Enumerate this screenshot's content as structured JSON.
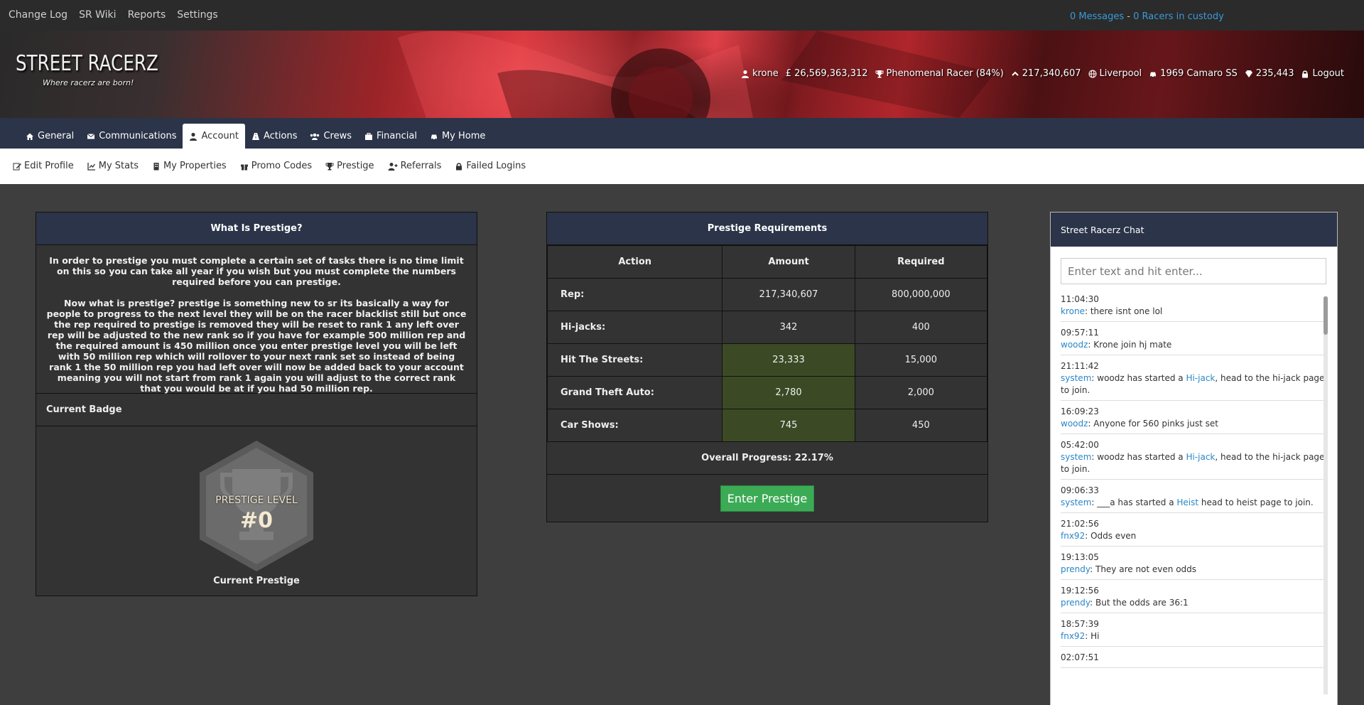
{
  "topbar": {
    "links": [
      "Change Log",
      "SR Wiki",
      "Reports",
      "Settings"
    ],
    "messages": "0 Messages",
    "separator": " - ",
    "custody": "0 Racers in custody"
  },
  "logo": {
    "title": "STREET RACERZ",
    "tagline": "Where racerz are born!"
  },
  "user": {
    "name": "krone",
    "cash": "£ 26,569,363,312",
    "rank": "Phenomenal Racer (84%)",
    "rep": "217,340,607",
    "city": "Liverpool",
    "car": "1969 Camaro SS",
    "points": "235,443",
    "logout": "Logout"
  },
  "nav": {
    "tabs": [
      {
        "label": "General",
        "icon": "home-icon"
      },
      {
        "label": "Communications",
        "icon": "envelope-icon"
      },
      {
        "label": "Account",
        "icon": "user-icon"
      },
      {
        "label": "Actions",
        "icon": "road-icon"
      },
      {
        "label": "Crews",
        "icon": "users-icon"
      },
      {
        "label": "Financial",
        "icon": "briefcase-icon"
      },
      {
        "label": "My Home",
        "icon": "car-icon"
      }
    ],
    "active": "Account"
  },
  "subnav": {
    "items": [
      {
        "label": "Edit Profile",
        "icon": "edit-icon"
      },
      {
        "label": "My Stats",
        "icon": "chart-icon"
      },
      {
        "label": "My Properties",
        "icon": "building-icon"
      },
      {
        "label": "Promo Codes",
        "icon": "gift-icon"
      },
      {
        "label": "Prestige",
        "icon": "trophy-icon"
      },
      {
        "label": "Referrals",
        "icon": "user-plus-icon"
      },
      {
        "label": "Failed Logins",
        "icon": "lock-icon"
      }
    ]
  },
  "info": {
    "title": "What Is Prestige?",
    "para1": "In order to prestige you must complete a certain set of tasks there is no time limit on this so you can take all year if you wish but you must complete the numbers required before you can prestige.",
    "para2": "Now what is prestige? prestige is something new to sr its basically a way for people to progress to the next level they will be on the racer blacklist still but once the rep required to prestige is removed they will be reset to rank 1 any left over rep will be adjusted to the new rank so if you have for example 500 million rep and the required amount is 450 million once you enter prestige level you will be left with 50 million rep which will rollover to your next rank set so instead of being rank 1 the 50 million rep you had left over will now be added back to your account meaning you will not start from rank 1 again you will adjust to the correct rank that you would be at if you had 50 million rep.",
    "badge_label": "Current Badge",
    "badge_line1": "PRESTIGE LEVEL",
    "badge_line2": "#0",
    "badge_caption": "Current Prestige"
  },
  "requirements": {
    "title": "Prestige Requirements",
    "headers": [
      "Action",
      "Amount",
      "Required"
    ],
    "rows": [
      {
        "action": "Rep:",
        "amount": "217,340,607",
        "required": "800,000,000",
        "met": false
      },
      {
        "action": "Hi-jacks:",
        "amount": "342",
        "required": "400",
        "met": false
      },
      {
        "action": "Hit The Streets:",
        "amount": "23,333",
        "required": "15,000",
        "met": true
      },
      {
        "action": "Grand Theft Auto:",
        "amount": "2,780",
        "required": "2,000",
        "met": true
      },
      {
        "action": "Car Shows:",
        "amount": "745",
        "required": "450",
        "met": true
      }
    ],
    "overall": "Overall Progress: 22.17%",
    "button": "Enter Prestige",
    "met_color": "#3b4a24"
  },
  "chat": {
    "title": "Street Racerz Chat",
    "placeholder": "Enter text and hit enter...",
    "messages": [
      {
        "time": "11:04:30",
        "user": "krone",
        "text": "there isnt one lol"
      },
      {
        "time": "09:57:11",
        "user": "woodz",
        "text": "Krone join hj mate"
      },
      {
        "time": "21:11:42",
        "user": "system",
        "pre": "woodz has started a ",
        "link": "Hi-jack",
        "post": ", head to the hi-jack page to join."
      },
      {
        "time": "16:09:23",
        "user": "woodz",
        "text": "Anyone for 560 pinks just set"
      },
      {
        "time": "05:42:00",
        "user": "system",
        "pre": "woodz has started a ",
        "link": "Hi-jack",
        "post": ", head to the hi-jack page to join."
      },
      {
        "time": "09:06:33",
        "user": "system",
        "pre": "___a has started a ",
        "link": "Heist",
        "post": " head to heist page to join."
      },
      {
        "time": "21:02:56",
        "user": "fnx92",
        "text": "Odds even"
      },
      {
        "time": "19:13:05",
        "user": "prendy",
        "text": "They are not even odds"
      },
      {
        "time": "19:12:56",
        "user": "prendy",
        "text": "But the odds are 36:1"
      },
      {
        "time": "18:57:39",
        "user": "fnx92",
        "text": "Hi"
      },
      {
        "time": "02:07:51",
        "user": "",
        "text": ""
      }
    ]
  },
  "colors": {
    "nav": "#2b3448",
    "accent_link": "#2a86c7",
    "button": "#3cab56"
  }
}
